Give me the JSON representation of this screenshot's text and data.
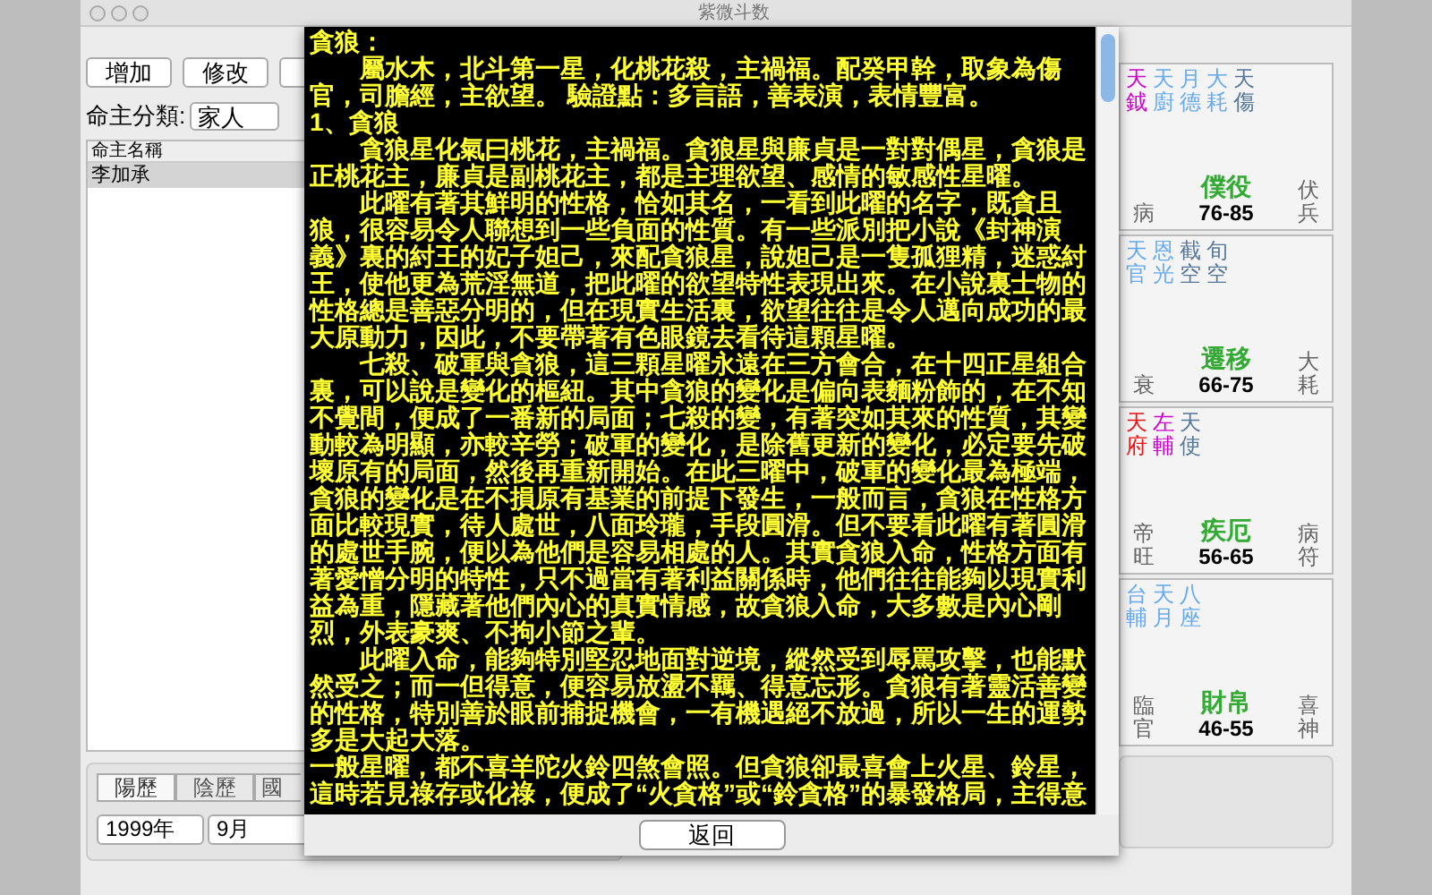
{
  "window": {
    "title": "紫微斗数"
  },
  "toolbar": {
    "buttons": [
      "增加",
      "修改"
    ]
  },
  "category": {
    "label": "命主分類:",
    "value": "家人"
  },
  "owner_list": {
    "header": "命主名稱",
    "rows": [
      {
        "name": "李加承",
        "selected": true
      }
    ]
  },
  "calendar_tabs": [
    {
      "label": "陽歷",
      "selected": true
    },
    {
      "label": "陰歷",
      "selected": false
    },
    {
      "label": "國",
      "selected": false
    }
  ],
  "date_selects": [
    "1999年",
    "9月"
  ],
  "sheet": {
    "paragraphs": [
      {
        "indented": false,
        "text": "貪狼："
      },
      {
        "indented": true,
        "text": "屬水木，北斗第一星，化桃花殺，主禍福。配癸甲幹，取象為傷官，司膽經，主欲望。 驗證點：多言語，善表演，表情豐富。"
      },
      {
        "indented": false,
        "text": "1、貪狼"
      },
      {
        "indented": true,
        "text": "貪狼星化氣曰桃花，主禍福。貪狼星與廉貞是一對對偶星，貪狼是正桃花主，廉貞是副桃花主，都是主理欲望、感情的敏感性星曜。"
      },
      {
        "indented": true,
        "text": "此曜有著其鮮明的性格，恰如其名，一看到此曜的名字，既貪且狼，很容易令人聯想到一些負面的性質。有一些派別把小說《封神演義》裏的紂王的妃子妲己，來配貪狼星，說妲己是一隻孤狸精，迷惑紂王，使他更為荒淫無道，把此曜的欲望特性表現出來。在小說裏士物的性格總是善惡分明的，但在現實生活裏，欲望往往是令人邁向成功的最大原動力，因此，不要帶著有色眼鏡去看待這顆星曜。"
      },
      {
        "indented": true,
        "text": "七殺、破軍與貪狼，這三顆星曜永遠在三方會合，在十四正星組合裏，可以說是變化的樞紐。其中貪狼的變化是偏向表麵粉飾的，在不知不覺間，便成了一番新的局面；七殺的變，有著突如其來的性質，其變動較為明顯，亦較辛勞；破軍的變化，是除舊更新的變化，必定要先破壞原有的局面，然後再重新開始。在此三曜中，破軍的變化最為極端，貪狼的變化是在不損原有基業的前提下發生，一般而言，貪狼在性格方面比較現實，待人處世，八面玲瓏，手段圓滑。但不要看此曜有著圓滑的處世手腕，便以為他們是容易相處的人。其實貪狼入命，性格方面有著愛憎分明的特性，只不過當有著利益關係時，他們往往能夠以現實利益為重，隱藏著他們內心的真實情感，故貪狼入命，大多數是內心剛烈，外表豪爽、不拘小節之輩。"
      },
      {
        "indented": true,
        "text": "此曜入命，能夠特別堅忍地面對逆境，縱然受到辱罵攻擊，也能默然受之；而一但得意，便容易放盪不羈、得意忘形。貪狼有著靈活善變的性格，特別善於眼前捕捉機會，一有機遇絕不放過，所以一生的運勢多是大起大落。"
      },
      {
        "indented": false,
        "text": "一般星曜，都不喜羊陀火鈴四煞會照。但貪狼卻最喜會上火星、鈴星，這時若見祿存或化祿，便成了“火貪格”或“鈴貪格”的暴發格局，主得意"
      }
    ],
    "button": "返回"
  },
  "palaces": [
    {
      "stars": [
        {
          "name": "天鉞",
          "color": "#cc00cc"
        },
        {
          "name": "天廚",
          "color": "#66aaee"
        },
        {
          "name": "月德",
          "color": "#66aaee"
        },
        {
          "name": "大耗",
          "color": "#66aaee"
        },
        {
          "name": "天傷",
          "color": "#557799"
        }
      ],
      "left": "病",
      "name": "僕役",
      "range": "76-85",
      "right": "伏兵"
    },
    {
      "stars": [
        {
          "name": "天官",
          "color": "#66aaee"
        },
        {
          "name": "恩光",
          "color": "#66aaee"
        },
        {
          "name": "截空",
          "color": "#557799"
        },
        {
          "name": "旬空",
          "color": "#557799"
        }
      ],
      "left": "衰",
      "name": "遷移",
      "range": "66-75",
      "right": "大耗"
    },
    {
      "stars": [
        {
          "name": "天府",
          "color": "#ee1111"
        },
        {
          "name": "左輔",
          "color": "#cc00cc"
        },
        {
          "name": "天使",
          "color": "#557799"
        }
      ],
      "left": "帝旺",
      "name": "疾厄",
      "range": "56-65",
      "right": "病符"
    },
    {
      "stars": [
        {
          "name": "台輔",
          "color": "#66aaee"
        },
        {
          "name": "天月",
          "color": "#66aaee"
        },
        {
          "name": "八座",
          "color": "#66aaee"
        }
      ],
      "left": "臨官",
      "name": "財帛",
      "range": "46-55",
      "right": "喜神"
    }
  ]
}
